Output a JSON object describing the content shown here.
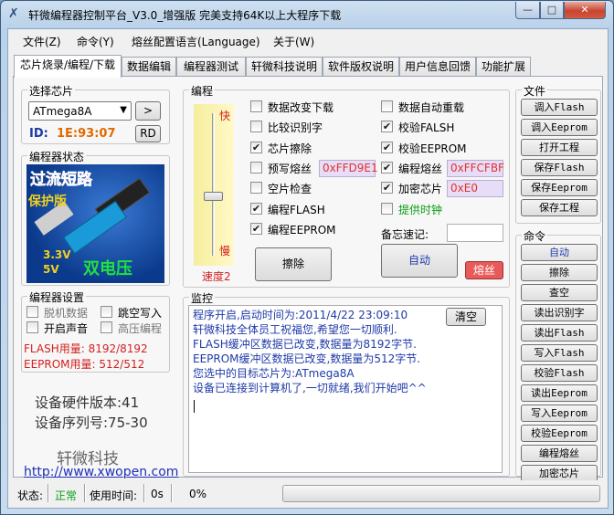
{
  "window": {
    "title": "轩微编程器控制平台_V3.0_增强版 完美支持64K以上大程序下载",
    "min": "—",
    "max": "□",
    "close": "✕"
  },
  "menu": [
    "文件(Z)",
    "命令(Y)",
    "熔丝配置语言(Language)",
    "关于(W)"
  ],
  "tabs": [
    "芯片烧录/编程/下载",
    "数据编辑",
    "编程器测试",
    "轩微科技说明",
    "软件版权说明",
    "用户信息回馈",
    "功能扩展"
  ],
  "chip": {
    "group_label": "选择芯片",
    "selected": "ATmega8A",
    "arrow_btn": ">",
    "id_label": "ID:",
    "id_value": "1E:93:07",
    "rd_btn": "RD"
  },
  "programmer_status": {
    "group_label": "编程器状态",
    "img_text1": "过流短路",
    "img_text2": "保护版",
    "img_volt1": "3.3V",
    "img_volt2": "5V",
    "img_text3": "双电压"
  },
  "settings": {
    "group_label": "编程器设置",
    "options": [
      "脱机数据",
      "跳空写入",
      "开启声音",
      "高压编程"
    ],
    "flash_usage": "FLASH用量: 8192/8192",
    "eeprom_usage": "EEPROM用量: 512/512"
  },
  "device": {
    "hw_version": "设备硬件版本:41",
    "serial": "设备序列号:75-30",
    "company": "轩微科技",
    "url": "http://www.xwopen.com"
  },
  "program": {
    "group_label": "编程",
    "speed_fast": "快",
    "speed_slow": "慢",
    "speed_label": "速度2",
    "speed_level": "2",
    "left_options": [
      {
        "label": "数据改变下载",
        "checked": false
      },
      {
        "label": "比较识别字",
        "checked": false
      },
      {
        "label": "芯片擦除",
        "checked": true
      },
      {
        "label": "预写熔丝",
        "checked": false
      },
      {
        "label": "空片检查",
        "checked": false
      },
      {
        "label": "编程FLASH",
        "checked": true
      },
      {
        "label": "编程EEPROM",
        "checked": true
      }
    ],
    "right_options": [
      {
        "label": "数据自动重载",
        "checked": false
      },
      {
        "label": "校验FALSH",
        "checked": true
      },
      {
        "label": "校验EEPROM",
        "checked": true
      },
      {
        "label": "编程熔丝",
        "checked": true
      },
      {
        "label": "加密芯片",
        "checked": true
      },
      {
        "label": "提供时钟",
        "checked": false
      }
    ],
    "prefuse_value": "0xFFD9E1",
    "fuse_value": "0xFFCFBF",
    "lock_value": "0xE0",
    "memo_label": "备忘速记:",
    "memo_value": "",
    "erase_btn": "擦除",
    "auto_btn": "自动",
    "fuse_btn": "熔丝"
  },
  "monitor": {
    "group_label": "监控",
    "clear_btn": "清空",
    "lines": [
      "程序开启,启动时间为:2011/4/22 23:09:10",
      "轩微科技全体员工祝福您,希望您一切顺利.",
      "FLASH缓冲区数据已改变,数据量为8192字节.",
      "EEPROM缓冲区数据已改变,数据量为512字节.",
      "您选中的目标芯片为:ATmega8A",
      "设备已连接到计算机了,一切就绪,我们开始吧^^"
    ]
  },
  "file_group": {
    "group_label": "文件",
    "buttons": [
      "调入Flash",
      "调入Eeprom",
      "打开工程",
      "保存Flash",
      "保存Eeprom",
      "保存工程"
    ]
  },
  "command_group": {
    "group_label": "命令",
    "buttons": [
      "自动",
      "擦除",
      "查空",
      "读出识别字",
      "读出Flash",
      "写入Flash",
      "校验Flash",
      "读出Eeprom",
      "写入Eeprom",
      "校验Eeprom",
      "编程熔丝",
      "加密芯片"
    ]
  },
  "status": {
    "label": "状态:",
    "value": "正常",
    "time_label": "使用时间:",
    "time_value": "0s",
    "progress_text": "0%",
    "progress_fraction": 0
  },
  "colors": {
    "accent_blue": "#1e3aa8",
    "status_green": "#0a9e12",
    "id_orange": "#e06a00",
    "usage_red": "#d42020",
    "fuse_button": "#e85a5a"
  }
}
